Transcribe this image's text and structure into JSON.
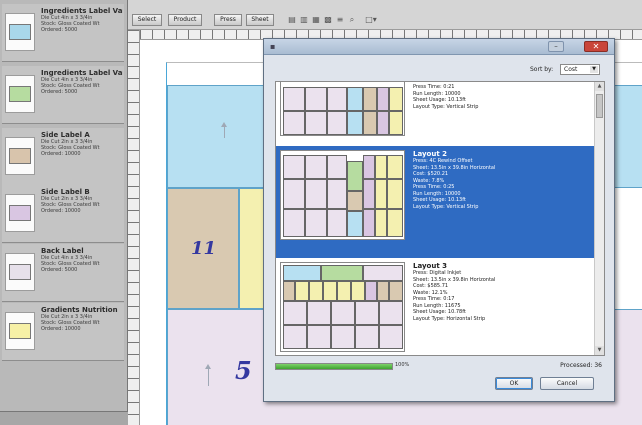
{
  "left_panel": {
    "items": [
      {
        "title": "Ingredients Label Var",
        "lines": [
          "Die Cut 4in x 3 3/4in",
          "Stock: Gloss Coated Wt",
          "Ordered: 5000"
        ],
        "color": "#a9d7ea"
      },
      {
        "title": "Ingredients Label Var",
        "lines": [
          "Die Cut 4in x 3 3/4in",
          "Stock: Gloss Coated Wt",
          "Ordered: 5000"
        ],
        "color": "#b6dca0"
      },
      {
        "title": "Side Label A",
        "lines": [
          "Die Cut 2in x 3 3/4in",
          "Stock: Gloss Coated Wt",
          "Ordered: 10000"
        ],
        "color": "#d8c4ac"
      },
      {
        "title": "Side Label B",
        "lines": [
          "Die Cut 2in x 3 3/4in",
          "Stock: Gloss Coated Wt",
          "Ordered: 10000"
        ],
        "color": "#d9c6e2"
      },
      {
        "title": "Back Label",
        "lines": [
          "Die Cut 4in x 3 3/4in",
          "Stock: Gloss Coated Wt",
          "Ordered: 5000"
        ],
        "color": "#e6e0ea"
      },
      {
        "title": "Gradients Nutrition",
        "lines": [
          "Die Cut 2in x 3 3/4in",
          "Stock: Gloss Coated Wt",
          "Ordered: 10000"
        ],
        "color": "#f6f0a6"
      }
    ]
  },
  "toolbar": {
    "buttons": [
      "Select",
      "Product",
      "Press",
      "Sheet"
    ],
    "icons": [
      "align-left-icon",
      "align-center-icon",
      "distribute-icon",
      "grid-icon",
      "list-icon",
      "zoom-icon",
      "dropdown-icon"
    ]
  },
  "canvas": {
    "labels": [
      "11",
      "5"
    ],
    "colors": {
      "blue": "#b7e0f2",
      "tan": "#d9c9b1",
      "yellow": "#f4f0b0",
      "lavender": "#ebe2ee"
    }
  },
  "dialog": {
    "close_glyph": "✕",
    "min_glyph": "–",
    "sort_label": "Sort by:",
    "sort_value": "Cost",
    "layouts": [
      {
        "title": "",
        "lines": [
          "Press Time: 0:21",
          "Run Length: 10000",
          "Sheet Usage: 10.13ft",
          "Layout Type: Vertical Strip"
        ],
        "selected": false
      },
      {
        "title": "Layout 2",
        "lines": [
          "Press: 4C Rewind Offset",
          "Sheet: 13.5in x 39.8in Horizontal",
          "Cost: $520.21",
          "Waste: 7.8%",
          "Press Time: 0:25",
          "Run Length: 10000",
          "Sheet Usage: 10.13ft",
          "Layout Type: Vertical Strip"
        ],
        "selected": true
      },
      {
        "title": "Layout 3",
        "lines": [
          "Press: Digital Inkjet",
          "Sheet: 13.5in x 39.8in Horizontal",
          "Cost: $585.71",
          "Waste: 12.1%",
          "Press Time: 0:17",
          "Run Length: 11675",
          "Sheet Usage: 10.78ft",
          "Layout Type: Horizontal Strip"
        ],
        "selected": false
      }
    ],
    "progress": 1.0,
    "progress_text": "100%",
    "processed_text": "Processed: 36",
    "ok_label": "OK",
    "cancel_label": "Cancel"
  }
}
